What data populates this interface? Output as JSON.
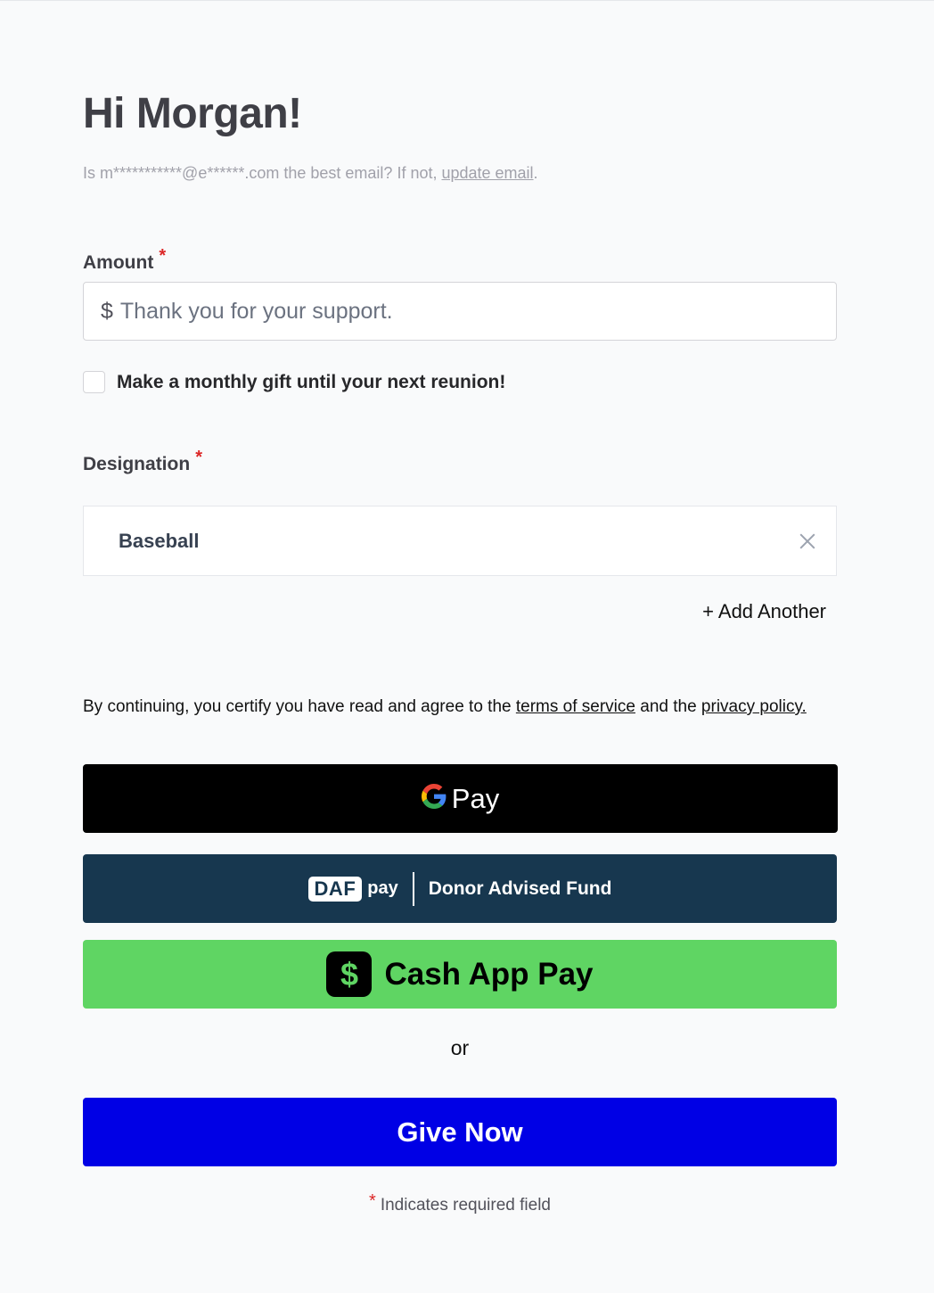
{
  "greeting": "Hi Morgan!",
  "email_note": {
    "prefix": "Is m***********@e******.com the best email? If not, ",
    "link": "update email",
    "suffix": "."
  },
  "amount": {
    "label": "Amount",
    "required_mark": "*",
    "currency": "$",
    "placeholder": "Thank you for your support."
  },
  "monthly": {
    "label": "Make a monthly gift until your next reunion!",
    "checked": false
  },
  "designation": {
    "label": "Designation",
    "required_mark": "*",
    "value": "Baseball",
    "add_another": "+ Add Another"
  },
  "terms": {
    "prefix": "By continuing, you certify you have read and agree to the ",
    "tos_link": "terms of service",
    "middle": " and the ",
    "privacy_link": "privacy policy.",
    "suffix": ""
  },
  "payments": {
    "gpay_label": "Pay",
    "daf_badge": "DAF",
    "daf_pay": "pay",
    "daf_label": "Donor Advised Fund",
    "cashapp_symbol": "$",
    "cashapp_label": "Cash App Pay"
  },
  "or_text": "or",
  "give_button": "Give Now",
  "required_note": {
    "mark": "*",
    "text": "Indicates required field"
  },
  "colors": {
    "gpay_bg": "#000000",
    "daf_bg": "#17374f",
    "cashapp_bg": "#5fd563",
    "give_bg": "#0000e5",
    "required": "#dc2626"
  }
}
